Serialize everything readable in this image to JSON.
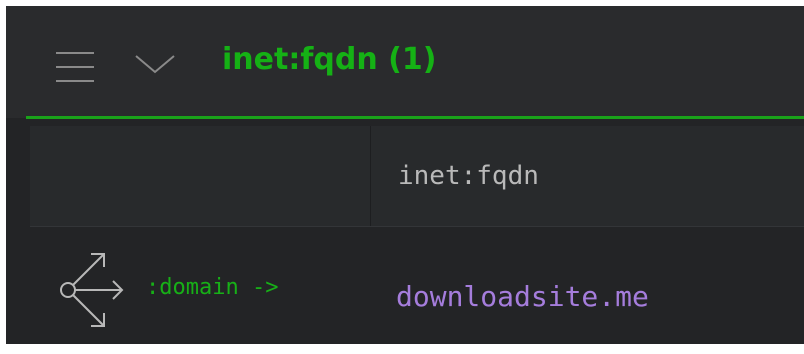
{
  "header": {
    "title": "inet:fqdn (1)",
    "menu_icon": "hamburger-menu-icon",
    "collapse_icon": "chevron-down-icon"
  },
  "table": {
    "columns": [
      {
        "label": "inet:fqdn"
      }
    ],
    "rows": [
      {
        "pivot_icon": "pivot-arrows-icon",
        "relation": ":domain ->",
        "value": "downloadsite.me"
      }
    ]
  },
  "colors": {
    "accent": "#1aa21a",
    "title": "#15b115",
    "relation": "#17b017",
    "value": "#a57ddc",
    "panel_bg": "#232426",
    "header_bg": "#2a2b2d"
  }
}
